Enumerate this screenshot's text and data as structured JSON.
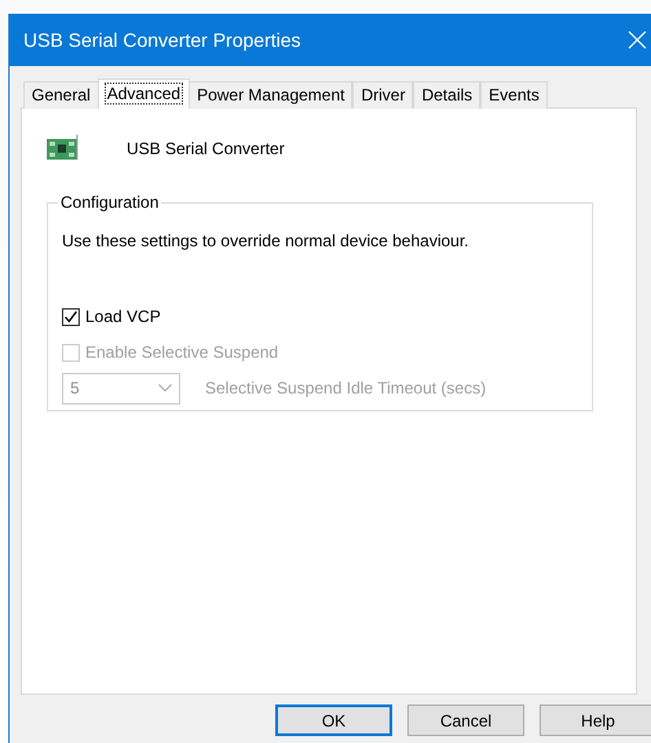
{
  "window": {
    "title": "USB Serial Converter Properties"
  },
  "tabs": [
    {
      "label": "General",
      "selected": false
    },
    {
      "label": "Advanced",
      "selected": true
    },
    {
      "label": "Power Management",
      "selected": false
    },
    {
      "label": "Driver",
      "selected": false
    },
    {
      "label": "Details",
      "selected": false
    },
    {
      "label": "Events",
      "selected": false
    }
  ],
  "device": {
    "name": "USB Serial Converter"
  },
  "group": {
    "title": "Configuration",
    "description": "Use these settings to override normal device behaviour.",
    "options": [
      {
        "kind": "checkbox",
        "label": "Load VCP",
        "checked": true,
        "disabled": false
      },
      {
        "kind": "checkbox",
        "label": "Enable Selective Suspend",
        "checked": false,
        "disabled": true
      }
    ],
    "timeout": {
      "label": "Selective Suspend Idle Timeout (secs)",
      "value": "5",
      "disabled": true
    }
  },
  "buttons": [
    {
      "label": "OK",
      "default": true
    },
    {
      "label": "Cancel",
      "default": false
    },
    {
      "label": "Help",
      "default": false
    }
  ]
}
